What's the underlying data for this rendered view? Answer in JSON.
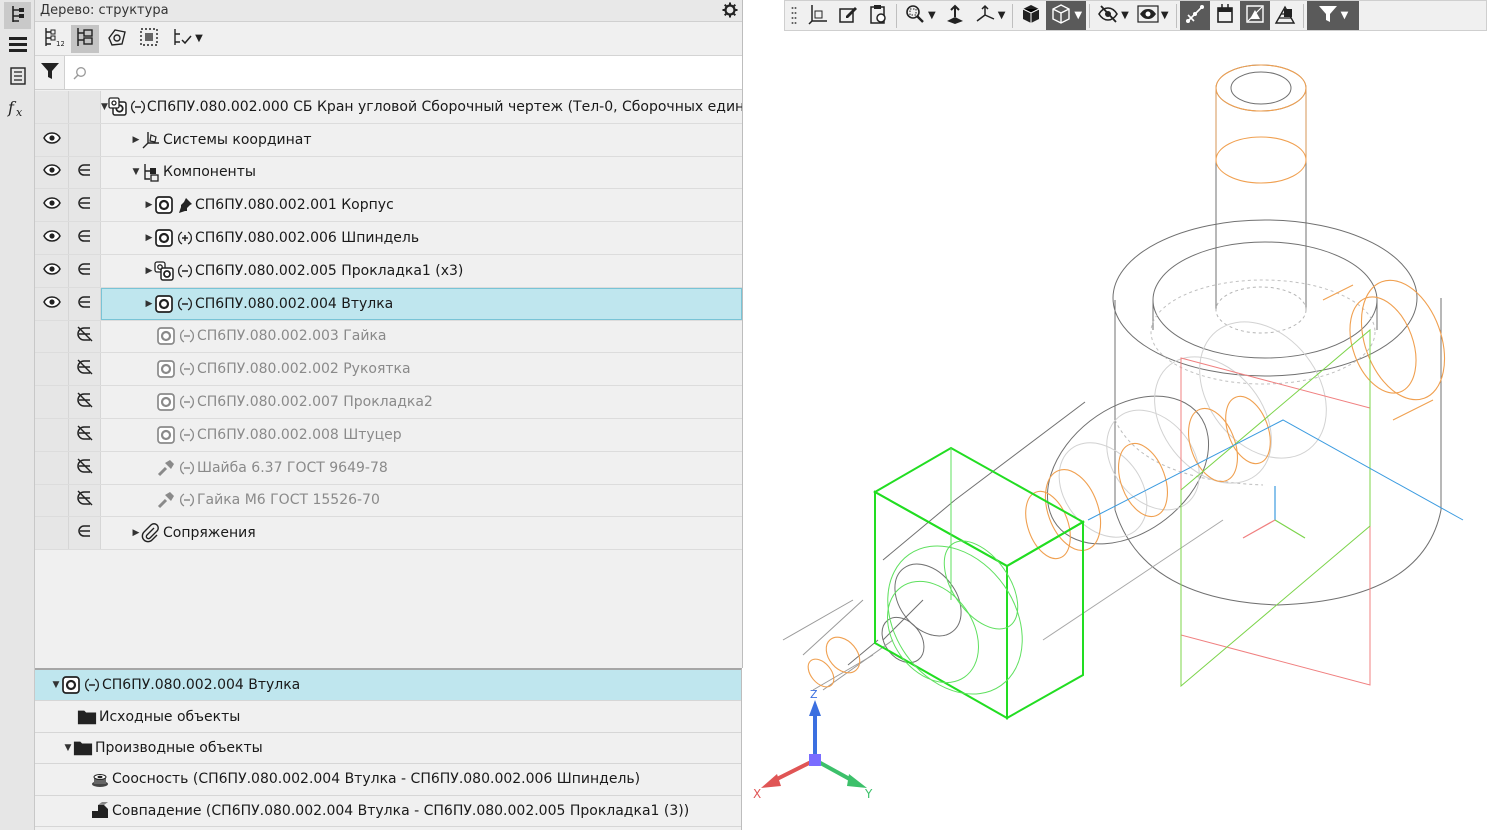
{
  "panel": {
    "title": "Дерево: структура",
    "filter_placeholder": ""
  },
  "tree": {
    "root": "СП6ПУ.080.002.000 СБ Кран угловой Сборочный чертеж (Тел-0, Сборочных едини",
    "coords": "Системы координат",
    "components": "Компоненты",
    "items": [
      {
        "label": "СП6ПУ.080.002.001 Корпус"
      },
      {
        "label": "СП6ПУ.080.002.006 Шпиндель"
      },
      {
        "label": "СП6ПУ.080.002.005 Прокладка1 (х3)"
      },
      {
        "label": "СП6ПУ.080.002.004 Втулка"
      },
      {
        "label": "СП6ПУ.080.002.003 Гайка"
      },
      {
        "label": "СП6ПУ.080.002.002 Рукоятка"
      },
      {
        "label": "СП6ПУ.080.002.007 Прокладка2"
      },
      {
        "label": "СП6ПУ.080.002.008 Штуцер"
      },
      {
        "label": "Шайба 6.37 ГОСТ 9649-78"
      },
      {
        "label": "Гайка М6 ГОСТ 15526-70"
      }
    ],
    "mates": "Сопряжения"
  },
  "relations": {
    "selected": "СП6ПУ.080.002.004 Втулка",
    "source": "Исходные объекты",
    "derived": "Производные объекты",
    "items": [
      {
        "label": "Соосность (СП6ПУ.080.002.004 Втулка  -  СП6ПУ.080.002.006 Шпиндель)"
      },
      {
        "label": "Совпадение (СП6ПУ.080.002.004 Втулка  -  СП6ПУ.080.002.005 Прокладка1 (3))"
      }
    ]
  },
  "axes": {
    "x": "X",
    "y": "Y",
    "z": "Z"
  },
  "colors": {
    "selection": "#bfe6ee",
    "orange": "#f0a050",
    "green": "#22dd22",
    "wire": "#707070"
  }
}
